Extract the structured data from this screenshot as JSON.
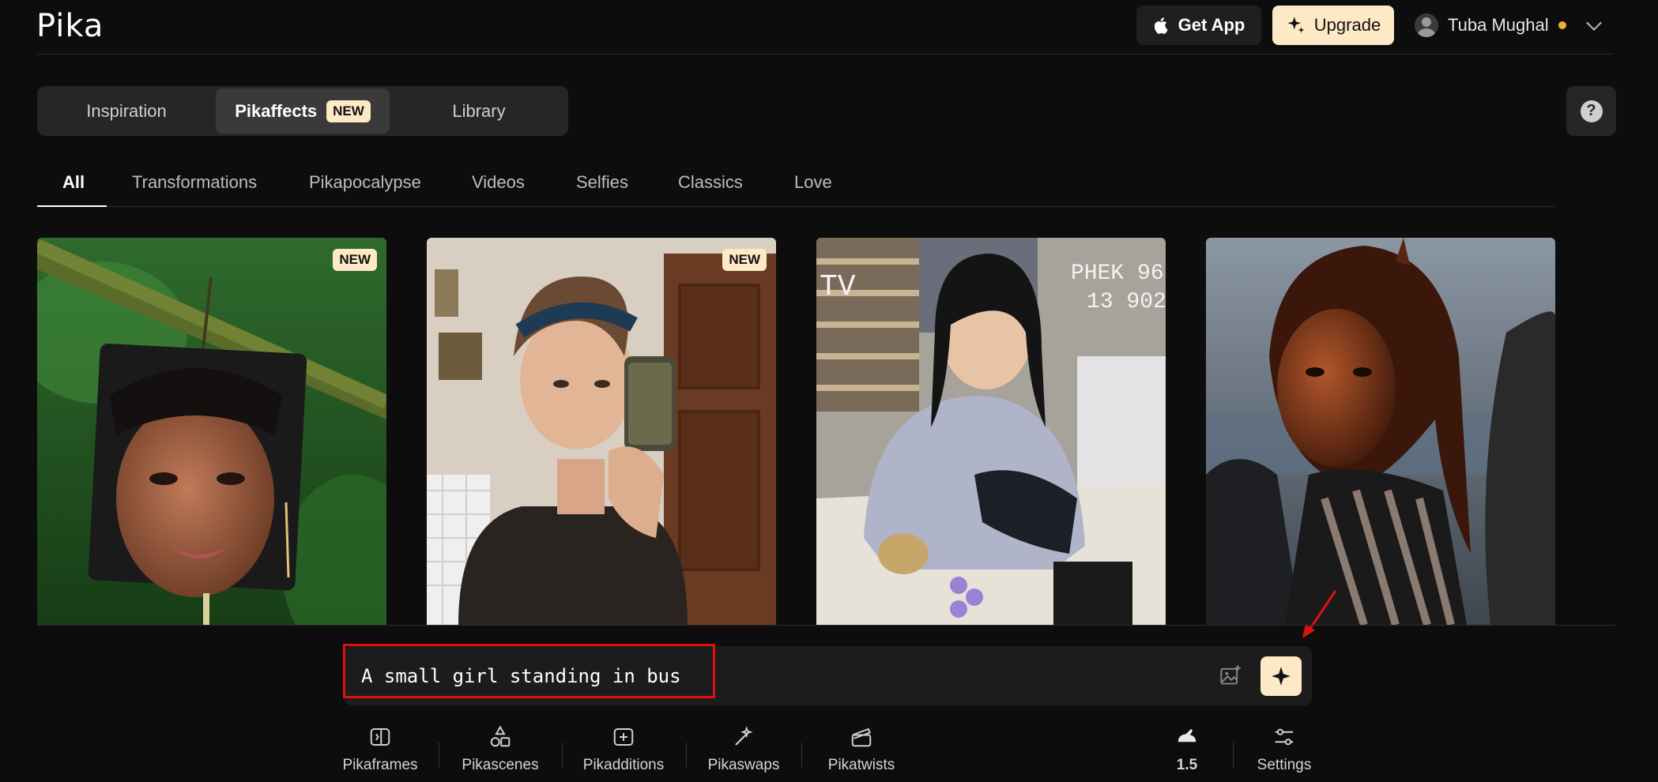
{
  "app": {
    "logo": "Pika"
  },
  "header": {
    "get_app_label": "Get App",
    "upgrade_label": "Upgrade",
    "user_name": "Tuba Mughal"
  },
  "main_tabs": [
    {
      "label": "Inspiration",
      "active": false
    },
    {
      "label": "Pikaffects",
      "active": true,
      "badge": "NEW"
    },
    {
      "label": "Library",
      "active": false
    }
  ],
  "help_label": "?",
  "categories": [
    {
      "label": "All",
      "active": true
    },
    {
      "label": "Transformations"
    },
    {
      "label": "Pikapocalypse"
    },
    {
      "label": "Videos"
    },
    {
      "label": "Selfies"
    },
    {
      "label": "Classics"
    },
    {
      "label": "Love"
    }
  ],
  "cards": [
    {
      "name": "card-jungle-face",
      "badge": "NEW"
    },
    {
      "name": "card-mirror-selfie",
      "badge": "NEW"
    },
    {
      "name": "card-vhs-shopper",
      "overlay_text": [
        "PHEK 96",
        "13 902"
      ],
      "overlay_label": "TV"
    },
    {
      "name": "card-bronze-statue"
    }
  ],
  "prompt": {
    "value": "A small girl standing in bus"
  },
  "tools": [
    {
      "label": "Pikaframes",
      "icon": "frames-icon"
    },
    {
      "label": "Pikascenes",
      "icon": "shapes-icon"
    },
    {
      "label": "Pikadditions",
      "icon": "add-frame-icon"
    },
    {
      "label": "Pikaswaps",
      "icon": "magic-wand-icon"
    },
    {
      "label": "Pikatwists",
      "icon": "clapperboard-icon"
    }
  ],
  "model": {
    "label": "1.5",
    "icon": "rabbit-icon"
  },
  "settings": {
    "label": "Settings",
    "icon": "sliders-icon"
  },
  "colors": {
    "accent": "#fde9c6",
    "background": "#0d0d0d",
    "highlight": "#e01010"
  }
}
